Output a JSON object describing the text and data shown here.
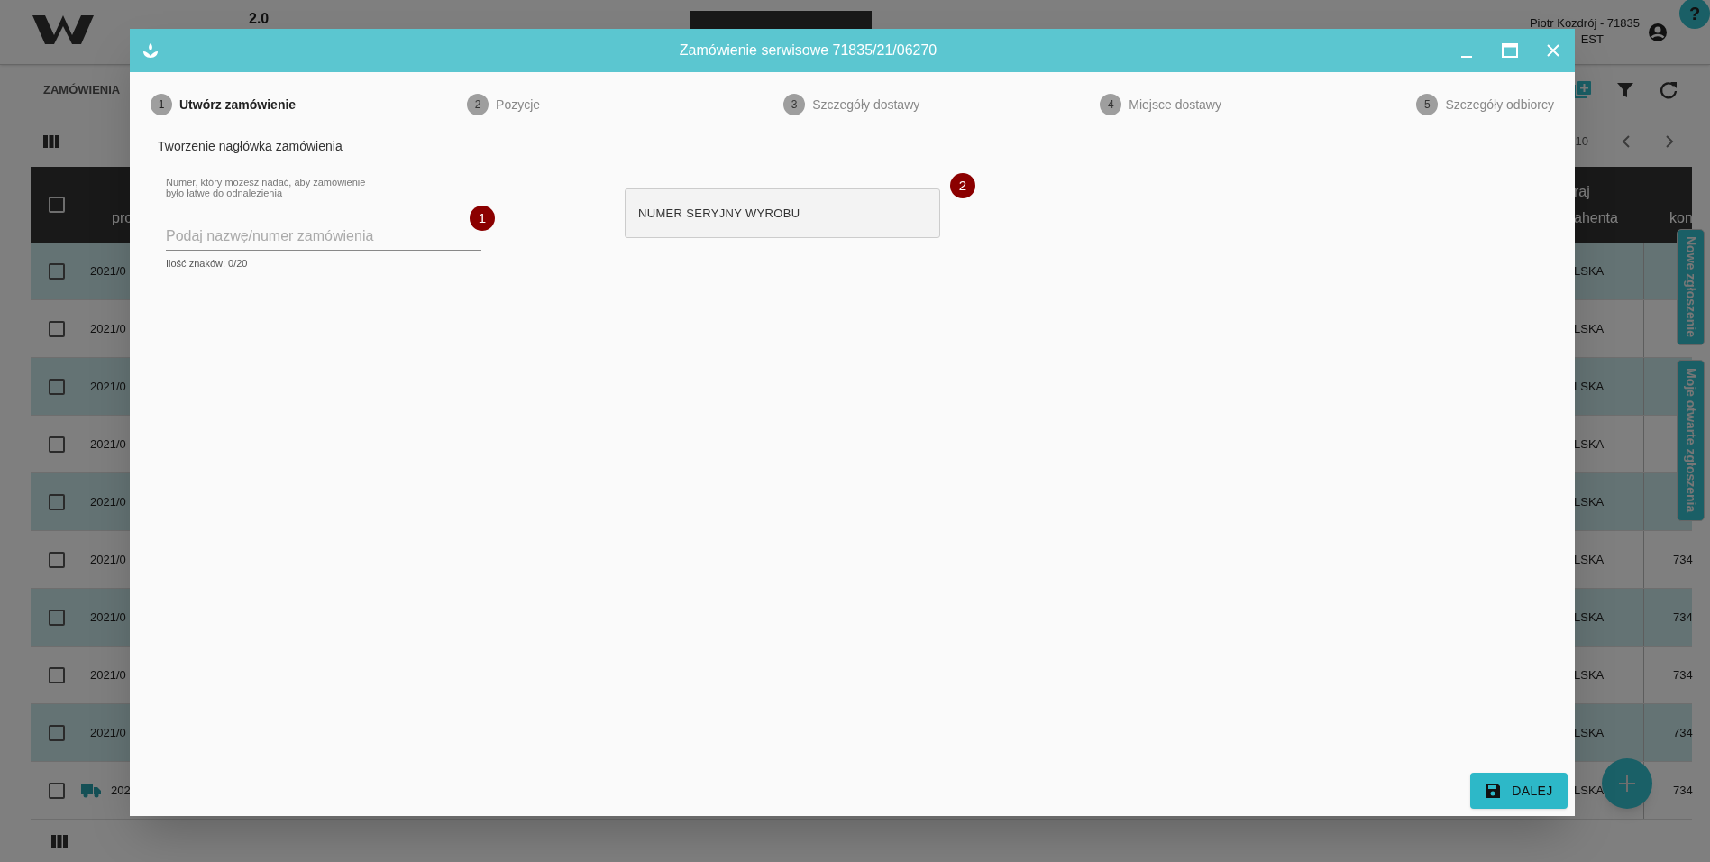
{
  "app": {
    "logo_superscript": "2.0",
    "user": "Piotr Kozdrój - 71835",
    "user_line2": "EST",
    "help": "?"
  },
  "toolbar": {
    "section": "ZAMÓWIENIA",
    "page_size": "10"
  },
  "table": {
    "all_checked": false,
    "header_left": "pro",
    "header_right": [
      "raj",
      "ahenta"
    ],
    "header_last": "kon",
    "rows": [
      {
        "checked": false,
        "column_1": "2021/0",
        "column_2": "LSKA",
        "truck": false
      },
      {
        "checked": false,
        "column_1": "2021/0",
        "column_2": "LSKA",
        "truck": false
      },
      {
        "checked": false,
        "column_1": "2021/0",
        "column_2": "LSKA",
        "truck": false
      },
      {
        "checked": false,
        "column_1": "2021/0",
        "column_2": "LSKA",
        "truck": false
      },
      {
        "checked": false,
        "column_1": "2021/0",
        "column_2": "LSKA",
        "truck": false
      },
      {
        "checked": false,
        "column_1": "2021/0",
        "column_2": "LSKA",
        "column_3": "734",
        "truck": false
      },
      {
        "checked": false,
        "column_1": "2021/0",
        "column_2": "LSKA",
        "column_3": "734",
        "truck": false
      },
      {
        "checked": false,
        "column_1": "2021/0",
        "column_2": "LSKA",
        "column_3": "734",
        "truck": false
      },
      {
        "checked": false,
        "column_1": "2021/0",
        "column_2": "LSKA",
        "column_3": "734",
        "truck": false
      },
      {
        "checked": false,
        "column_1": "202",
        "column_2": "LSKA",
        "column_3": "734",
        "truck": true
      }
    ]
  },
  "side_tabs": [
    "Nowe zgłoszenie",
    "Moje otwarte zgłoszenia"
  ],
  "dialog": {
    "title": "Zamówienie serwisowe 71835/21/06270",
    "steps": [
      {
        "number": "1",
        "label": "Utwórz zamówienie",
        "selected": true
      },
      {
        "number": "2",
        "label": "Pozycje",
        "selected": false
      },
      {
        "number": "3",
        "label": "Szczegóły dostawy",
        "selected": false
      },
      {
        "number": "4",
        "label": "Miejsce dostawy",
        "selected": false
      },
      {
        "number": "5",
        "label": "Szczegóły odbiorcy",
        "selected": false
      }
    ],
    "section_title": "Tworzenie nagłówka zamówienia",
    "order_field": {
      "hint": "Numer, który możesz nadać, aby zamówienie\nbyło łatwe do odnalezienia",
      "placeholder": "Podaj nazwę/numer zamówienia",
      "counter": "Ilość znaków: 0/20",
      "badge": "1"
    },
    "serial_button": {
      "label": "NUMER SERYJNY WYROBU",
      "badge": "2"
    },
    "next_button": "DALEJ"
  }
}
